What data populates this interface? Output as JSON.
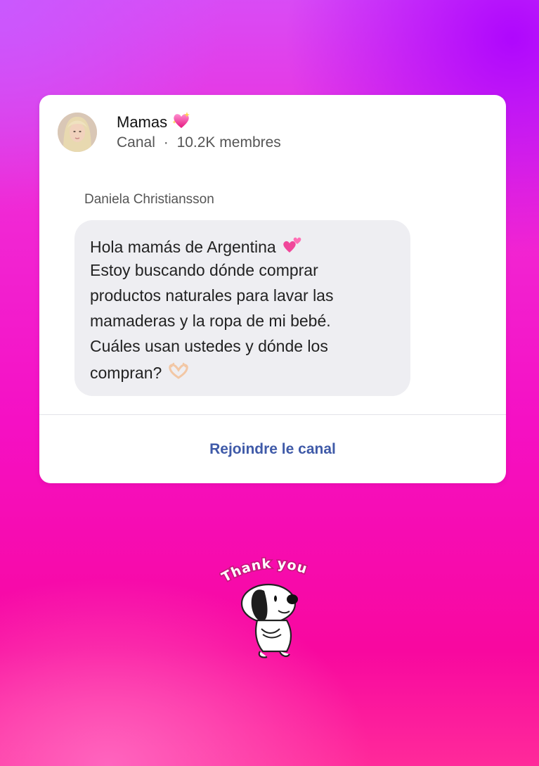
{
  "channel": {
    "name": "Mamas",
    "type_label": "Canal",
    "separator": "·",
    "members": "10.2K membres"
  },
  "message": {
    "sender": "Daniela Christiansson",
    "lines": [
      "Hola mamás de Argentina",
      "Estoy buscando dónde comprar",
      "productos naturales para lavar las",
      "mamaderas y la ropa de mi bebé.",
      "Cuáles usan ustedes y dónde los",
      "compran?"
    ]
  },
  "actions": {
    "join_label": "Rejoindre le canal"
  },
  "sticker": {
    "text": "Thank you"
  },
  "colors": {
    "accent": "#3f5aa8",
    "bubble": "#eeeef2",
    "heart": "#ff4fa3"
  },
  "icons": {
    "channel_emoji": "sparkling-heart-icon",
    "message_emoji": "two-hearts-icon",
    "end_emoji": "heart-hands-icon"
  }
}
